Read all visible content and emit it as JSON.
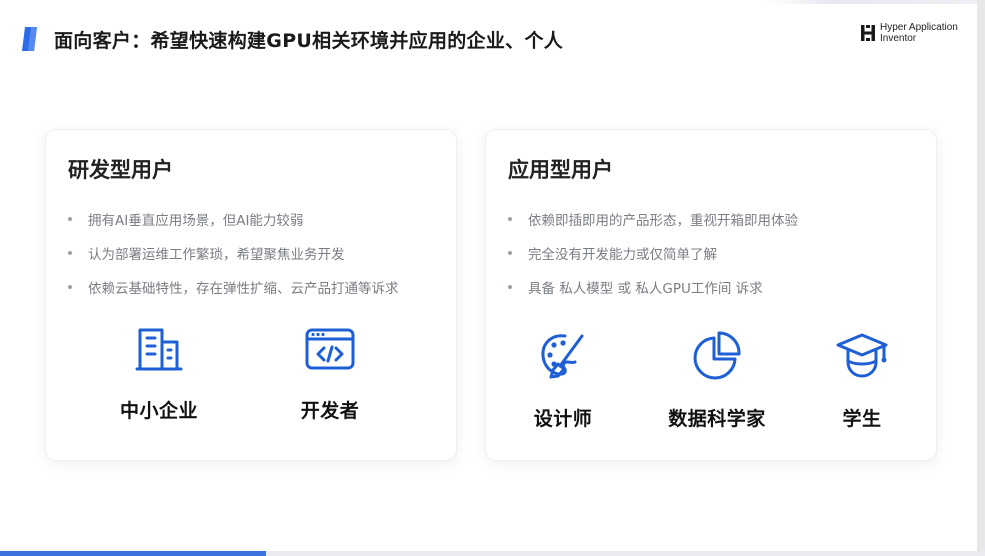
{
  "header": {
    "title": "面向客户：希望快速构建GPU相关环境并应用的企业、个人",
    "brand_line1": "Hyper Application",
    "brand_line2": "Inventor"
  },
  "colors": {
    "accent": "#1f5fd6",
    "logo_blue": "#2e6be6",
    "progress": "#3b73e0"
  },
  "progress": {
    "fraction": 0.27
  },
  "cards": [
    {
      "title": "研发型用户",
      "bullets": [
        "拥有AI垂直应用场景，但AI能力较弱",
        "认为部署运维工作繁琐，希望聚焦业务开发",
        "依赖云基础特性，存在弹性扩缩、云产品打通等诉求"
      ],
      "icons": [
        {
          "icon": "building-icon",
          "label": "中小企业"
        },
        {
          "icon": "code-window-icon",
          "label": "开发者"
        }
      ]
    },
    {
      "title": "应用型用户",
      "bullets": [
        "依赖即插即用的产品形态，重视开箱即用体验",
        "完全没有开发能力或仅简单了解",
        "具备 私人模型 或 私人GPU工作间 诉求"
      ],
      "icons": [
        {
          "icon": "palette-brush-icon",
          "label": "设计师"
        },
        {
          "icon": "pie-chart-icon",
          "label": "数据科学家"
        },
        {
          "icon": "graduation-cap-icon",
          "label": "学生"
        }
      ]
    }
  ]
}
